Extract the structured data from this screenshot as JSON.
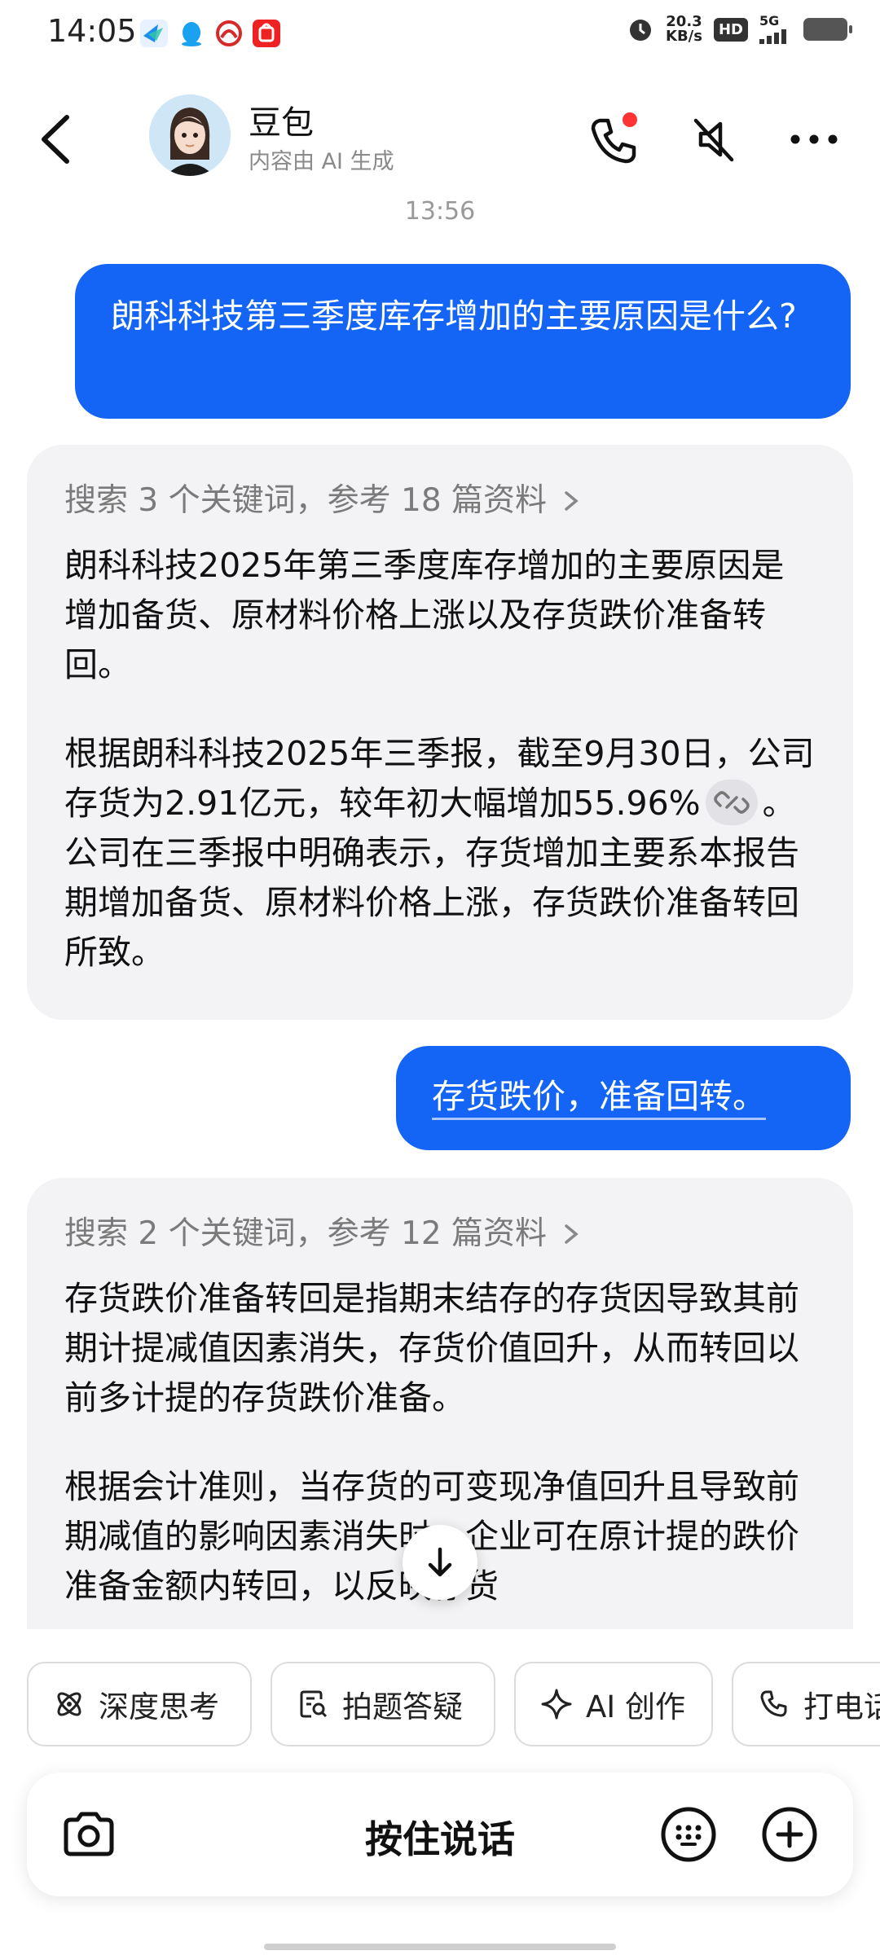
{
  "status_bar": {
    "time": "14:05",
    "net_speed_value": "20.3",
    "net_speed_unit": "KB/s",
    "hd_label": "HD",
    "network_label": "5G"
  },
  "header": {
    "title": "豆包",
    "subtitle": "内容由 AI 生成",
    "icons": [
      "back-arrow",
      "phone-call",
      "mute",
      "more"
    ]
  },
  "chat": {
    "timestamp": "13:56",
    "messages": [
      {
        "role": "user",
        "text": "朗科科技第三季度库存增加的主要原因是什么?"
      },
      {
        "role": "assistant",
        "search_summary": "搜索 3 个关键词，参考 18 篇资料",
        "paragraphs": [
          "朗科科技2025年第三季度库存增加的主要原因是增加备货、原材料价格上涨以及存货跌价准备转回。",
          "根据朗科科技2025年三季报，截至9月30日，公司存货为2.91亿元，较年初大幅增加55.96%"
        ],
        "paragraph2_after_link": "。公司在三季报中明确表示，存货增加主要系本报告期增加备货、原材料价格上涨，存货跌价准备转回所致。"
      },
      {
        "role": "user",
        "text": "存货跌价，准备回转。"
      },
      {
        "role": "assistant",
        "search_summary": "搜索 2 个关键词，参考 12 篇资料",
        "paragraphs": [
          "存货跌价准备转回是指期末结存的存货因导致其前期计提减值因素消失，存货价值回升，从而转回以前多计提的存货跌价准备。",
          "根据会计准则，当存货的可变现净值回升且导致前期减值的影响因素消失时，企业可在原计提的跌价准备金额内转回，以反映存货"
        ]
      }
    ]
  },
  "quick_actions": [
    {
      "label": "深度思考",
      "icon": "atom-icon"
    },
    {
      "label": "拍题答疑",
      "icon": "scan-question-icon"
    },
    {
      "label": "AI 创作",
      "icon": "sparkle-icon"
    },
    {
      "label": "打电话",
      "icon": "phone-icon"
    }
  ],
  "input_bar": {
    "hold_to_talk": "按住说话",
    "icons": [
      "camera-icon",
      "keyboard-icon",
      "plus-icon"
    ]
  },
  "colors": {
    "user_bubble": "#1465f5",
    "ai_bubble": "#f3f3f5",
    "notification_dot": "#ff3333"
  }
}
